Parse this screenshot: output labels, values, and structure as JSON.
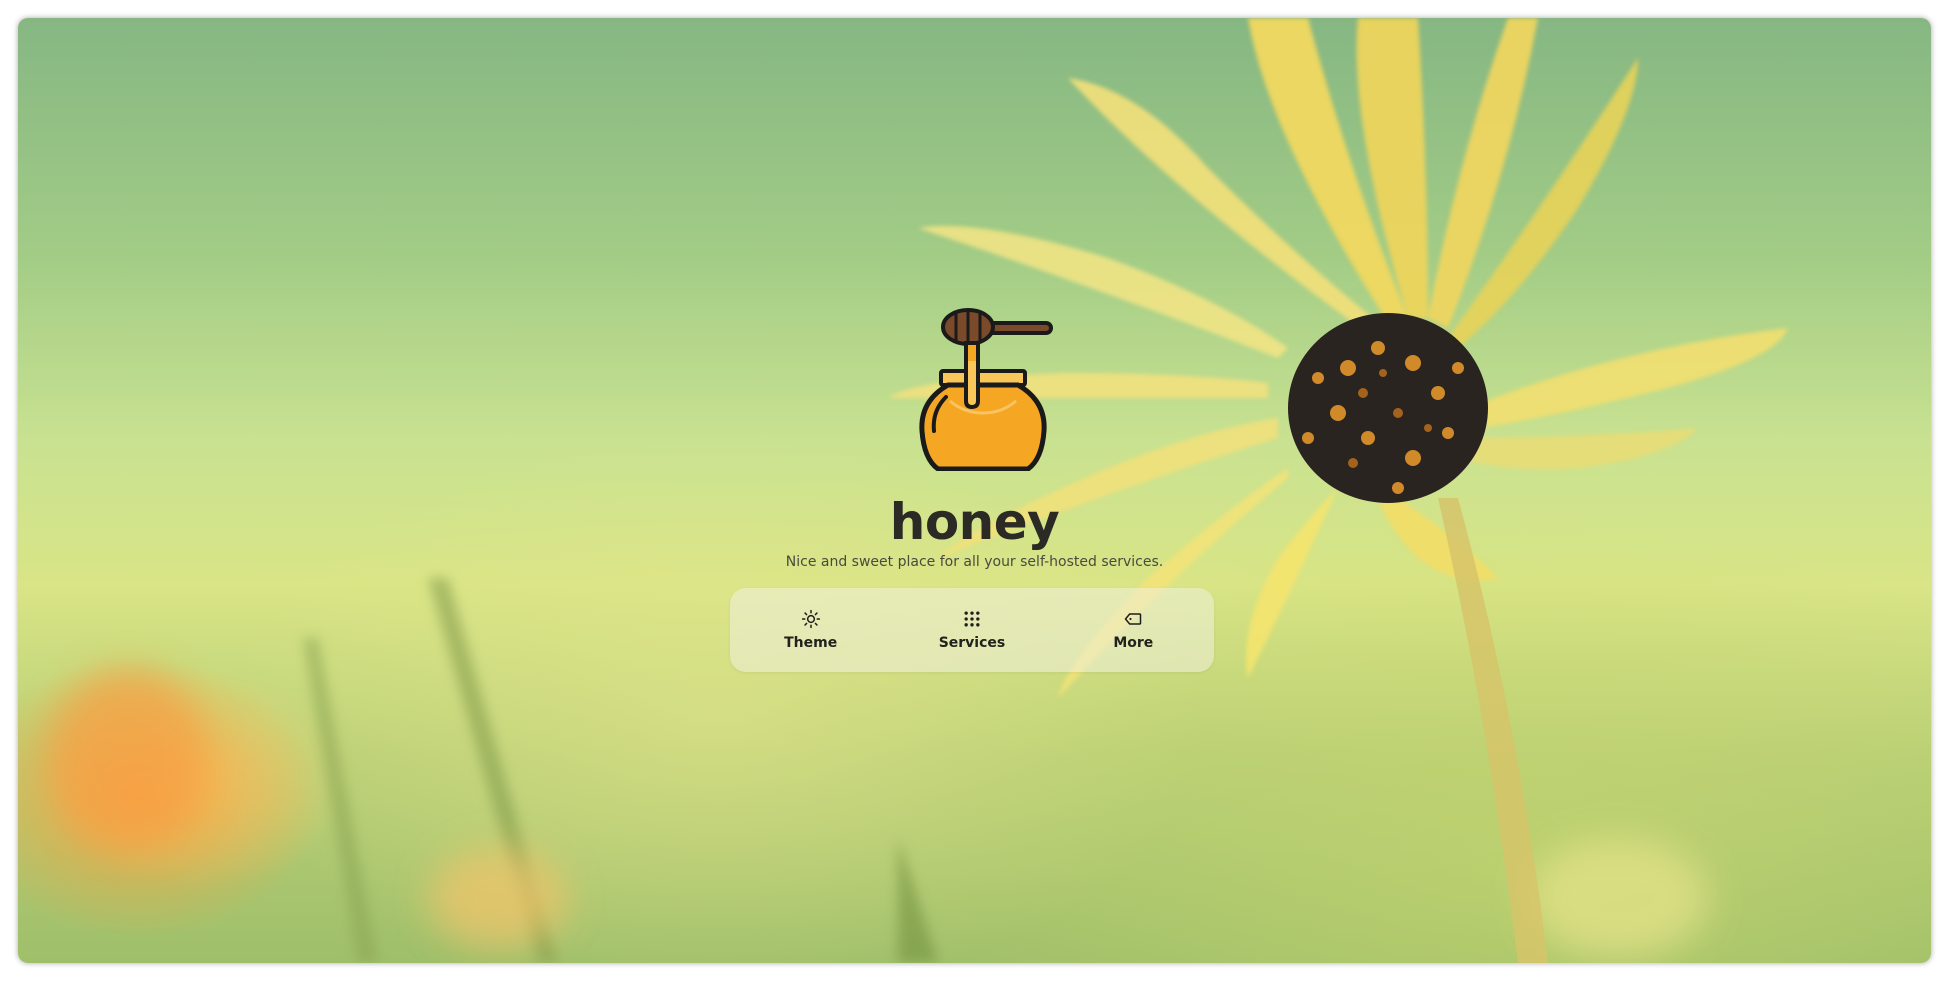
{
  "app": {
    "title": "honey",
    "subtitle": "Nice and sweet place for all your self-hosted services.",
    "logo_icon": "honey-pot-icon"
  },
  "toolbar": {
    "items": [
      {
        "label": "Theme",
        "icon": "sun-icon"
      },
      {
        "label": "Services",
        "icon": "grid-dots-icon"
      },
      {
        "label": "More",
        "icon": "tag-icon"
      }
    ]
  },
  "colors": {
    "title": "#2b2a24",
    "honey": "#f5a623",
    "outline": "#1a1a1a"
  }
}
